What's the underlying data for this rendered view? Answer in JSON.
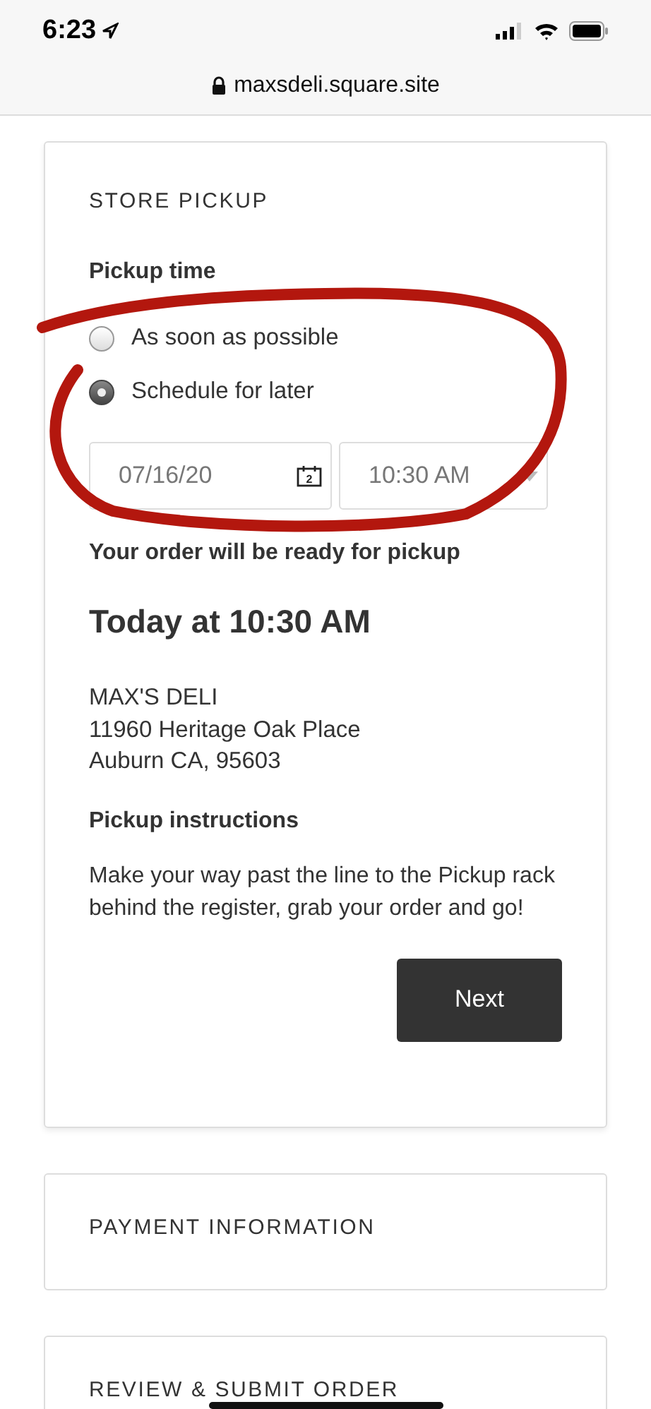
{
  "status_bar": {
    "time": "6:23"
  },
  "address_bar": {
    "url": "maxsdeli.square.site"
  },
  "store_pickup": {
    "heading": "STORE PICKUP",
    "pickup_time_label": "Pickup time",
    "options": [
      {
        "label": "As soon as possible",
        "selected": false
      },
      {
        "label": "Schedule for later",
        "selected": true
      }
    ],
    "date_field": {
      "value": "07/16/20",
      "calendar_day": "2"
    },
    "time_field": {
      "value": "10:30 AM"
    },
    "ready_label": "Your order will be ready for pickup",
    "ready_time": "Today at 10:30 AM",
    "address_lines": [
      "MAX'S DELI",
      "11960 Heritage Oak Place",
      "Auburn CA, 95603"
    ],
    "instructions_heading": "Pickup instructions",
    "instructions": "Make your way past the line to the Pickup rack behind the register, grab your order and go!",
    "next_button": "Next"
  },
  "sections": [
    {
      "heading": "PAYMENT INFORMATION"
    },
    {
      "heading": "REVIEW & SUBMIT ORDER"
    }
  ]
}
